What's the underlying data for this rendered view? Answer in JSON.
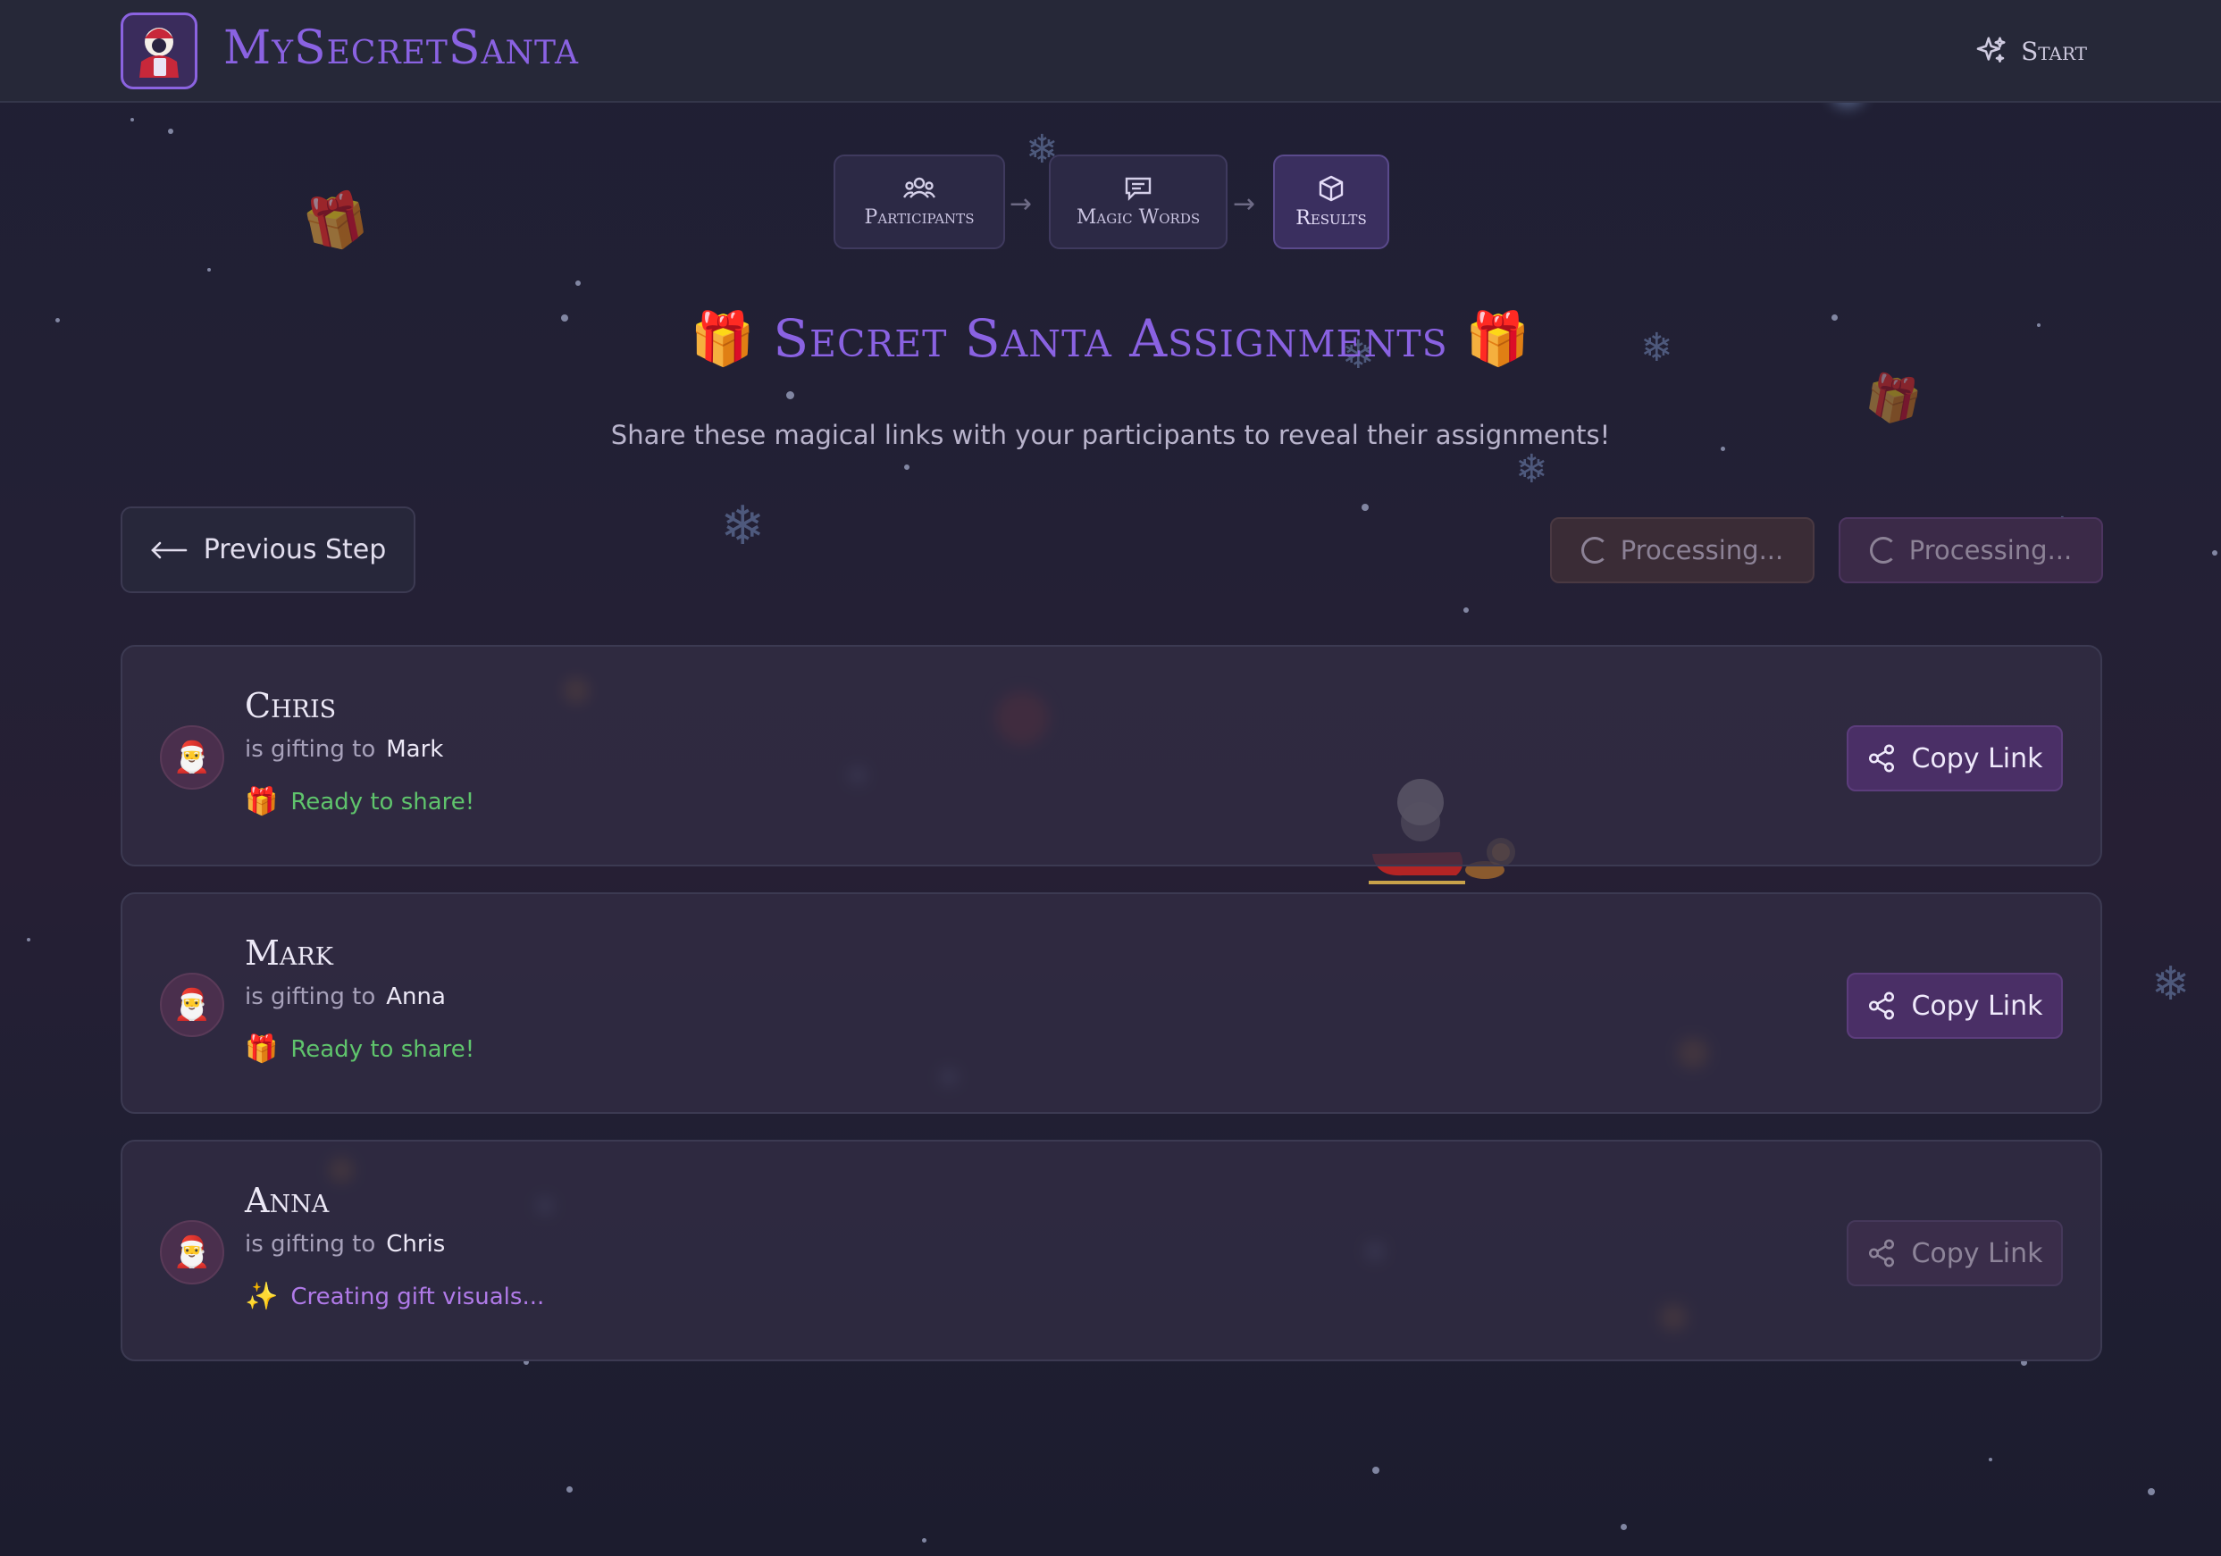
{
  "header": {
    "app_title": "MySecretSanta",
    "start_label": "Start"
  },
  "stepper": {
    "steps": [
      {
        "label": "Participants",
        "icon": "users-icon",
        "active": false
      },
      {
        "label": "Magic Words",
        "icon": "message-icon",
        "active": false
      },
      {
        "label": "Results",
        "icon": "box-icon",
        "active": true
      }
    ],
    "arrow": "→"
  },
  "main": {
    "title": "Secret Santa Assignments",
    "title_emoji": "🎁",
    "subtitle": "Share these magical links with your participants to reveal their assignments!",
    "prev_label": "Previous Step",
    "processing_labels": [
      "Processing...",
      "Processing..."
    ]
  },
  "assignments": [
    {
      "name": "Chris",
      "gifting_text": "is gifting to",
      "target": "Mark",
      "status": "Ready to share!",
      "status_emoji": "🎁",
      "copy_label": "Copy Link",
      "copy_enabled": true
    },
    {
      "name": "Mark",
      "gifting_text": "is gifting to",
      "target": "Anna",
      "status": "Ready to share!",
      "status_emoji": "🎁",
      "copy_label": "Copy Link",
      "copy_enabled": true
    },
    {
      "name": "Anna",
      "gifting_text": "is gifting to",
      "target": "Chris",
      "status": "Creating gift visuals...",
      "status_emoji": "✨",
      "copy_label": "Copy Link",
      "copy_enabled": false
    }
  ],
  "colors": {
    "accent": "#8a62e2",
    "ready": "#5fc46c",
    "creating": "#b07ae8",
    "background": "#232035"
  }
}
